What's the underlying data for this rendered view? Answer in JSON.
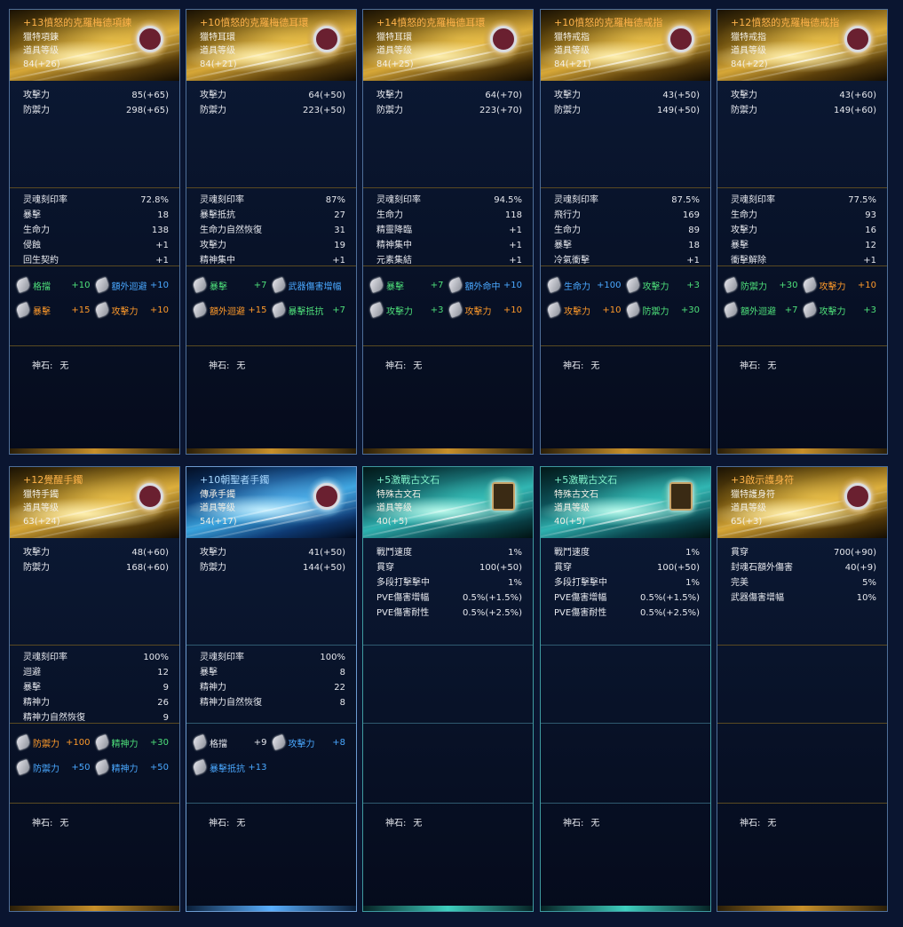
{
  "godstone_label": "神石:",
  "cards": [
    {
      "theme": "gold",
      "name": "+13憤怒的克羅梅德項鍊",
      "type": "獵特項鍊",
      "level_label": "道具等级",
      "level": "84(+26)",
      "icon": "necklace-icon",
      "base_stats": [
        {
          "k": "攻擊力",
          "v": "85(+65)"
        },
        {
          "k": "防禦力",
          "v": "298(+65)"
        }
      ],
      "bonus_stats": [
        {
          "k": "灵魂刻印率",
          "v": "72.8%"
        },
        {
          "k": "暴擊",
          "v": "18"
        },
        {
          "k": "生命力",
          "v": "138"
        },
        {
          "k": "侵蝕",
          "v": "+1"
        },
        {
          "k": "回生契約",
          "v": "+1"
        }
      ],
      "stones": [
        {
          "label": "格擋",
          "value": "+10",
          "color": "green"
        },
        {
          "label": "額外迴避",
          "value": "+10",
          "color": "blue"
        },
        {
          "label": "暴擊",
          "value": "+15",
          "color": "orange"
        },
        {
          "label": "攻擊力",
          "value": "+10",
          "color": "orange"
        }
      ],
      "godstone": "无"
    },
    {
      "theme": "gold",
      "name": "+10憤怒的克羅梅德耳環",
      "type": "獵特耳環",
      "level_label": "道具等级",
      "level": "84(+21)",
      "icon": "earring-icon",
      "base_stats": [
        {
          "k": "攻擊力",
          "v": "64(+50)"
        },
        {
          "k": "防禦力",
          "v": "223(+50)"
        }
      ],
      "bonus_stats": [
        {
          "k": "灵魂刻印率",
          "v": "87%"
        },
        {
          "k": "暴擊抵抗",
          "v": "27"
        },
        {
          "k": "生命力自然恢復",
          "v": "31"
        },
        {
          "k": "攻擊力",
          "v": "19"
        },
        {
          "k": "精神集中",
          "v": "+1"
        }
      ],
      "stones": [
        {
          "label": "暴擊",
          "value": "+7",
          "color": "green"
        },
        {
          "label": "武器傷害增幅",
          "value": "",
          "color": "blue"
        },
        {
          "label": "額外迴避",
          "value": "+15",
          "color": "orange"
        },
        {
          "label": "暴擊抵抗",
          "value": "+7",
          "color": "green"
        }
      ],
      "godstone": "无"
    },
    {
      "theme": "gold",
      "name": "+14憤怒的克羅梅德耳環",
      "type": "獵特耳環",
      "level_label": "道具等级",
      "level": "84(+25)",
      "icon": "earring-icon",
      "base_stats": [
        {
          "k": "攻擊力",
          "v": "64(+70)"
        },
        {
          "k": "防禦力",
          "v": "223(+70)"
        }
      ],
      "bonus_stats": [
        {
          "k": "灵魂刻印率",
          "v": "94.5%"
        },
        {
          "k": "生命力",
          "v": "118"
        },
        {
          "k": "精靈降臨",
          "v": "+1"
        },
        {
          "k": "精神集中",
          "v": "+1"
        },
        {
          "k": "元素集結",
          "v": "+1"
        }
      ],
      "stones": [
        {
          "label": "暴擊",
          "value": "+7",
          "color": "green"
        },
        {
          "label": "額外命中",
          "value": "+10",
          "color": "blue"
        },
        {
          "label": "攻擊力",
          "value": "+3",
          "color": "green"
        },
        {
          "label": "攻擊力",
          "value": "+10",
          "color": "orange"
        }
      ],
      "godstone": "无"
    },
    {
      "theme": "gold",
      "name": "+10憤怒的克羅梅德戒指",
      "type": "獵特戒指",
      "level_label": "道具等级",
      "level": "84(+21)",
      "icon": "ring-icon",
      "base_stats": [
        {
          "k": "攻擊力",
          "v": "43(+50)"
        },
        {
          "k": "防禦力",
          "v": "149(+50)"
        }
      ],
      "bonus_stats": [
        {
          "k": "灵魂刻印率",
          "v": "87.5%"
        },
        {
          "k": "飛行力",
          "v": "169"
        },
        {
          "k": "生命力",
          "v": "89"
        },
        {
          "k": "暴擊",
          "v": "18"
        },
        {
          "k": "冷氣衝擊",
          "v": "+1"
        }
      ],
      "stones": [
        {
          "label": "生命力",
          "value": "+100",
          "color": "blue"
        },
        {
          "label": "攻擊力",
          "value": "+3",
          "color": "green"
        },
        {
          "label": "攻擊力",
          "value": "+10",
          "color": "orange"
        },
        {
          "label": "防禦力",
          "value": "+30",
          "color": "green"
        }
      ],
      "godstone": "无"
    },
    {
      "theme": "gold",
      "name": "+12憤怒的克羅梅德戒指",
      "type": "獵特戒指",
      "level_label": "道具等级",
      "level": "84(+22)",
      "icon": "ring-icon",
      "base_stats": [
        {
          "k": "攻擊力",
          "v": "43(+60)"
        },
        {
          "k": "防禦力",
          "v": "149(+60)"
        }
      ],
      "bonus_stats": [
        {
          "k": "灵魂刻印率",
          "v": "77.5%"
        },
        {
          "k": "生命力",
          "v": "93"
        },
        {
          "k": "攻擊力",
          "v": "16"
        },
        {
          "k": "暴擊",
          "v": "12"
        },
        {
          "k": "衝擊解除",
          "v": "+1"
        }
      ],
      "stones": [
        {
          "label": "防禦力",
          "value": "+30",
          "color": "green"
        },
        {
          "label": "攻擊力",
          "value": "+10",
          "color": "orange"
        },
        {
          "label": "額外迴避",
          "value": "+7",
          "color": "green"
        },
        {
          "label": "攻擊力",
          "value": "+3",
          "color": "green"
        }
      ],
      "godstone": "无"
    },
    {
      "theme": "gold",
      "name": "+12覺醒手鐲",
      "type": "獵特手鐲",
      "level_label": "道具等级",
      "level": "63(+24)",
      "icon": "bracelet-icon",
      "base_stats": [
        {
          "k": "攻擊力",
          "v": "48(+60)"
        },
        {
          "k": "防禦力",
          "v": "168(+60)"
        }
      ],
      "bonus_stats": [
        {
          "k": "灵魂刻印率",
          "v": "100%"
        },
        {
          "k": "迴避",
          "v": "12"
        },
        {
          "k": "暴擊",
          "v": "9"
        },
        {
          "k": "精神力",
          "v": "26"
        },
        {
          "k": "精神力自然恢復",
          "v": "9"
        }
      ],
      "stones": [
        {
          "label": "防禦力",
          "value": "+100",
          "color": "orange"
        },
        {
          "label": "精神力",
          "value": "+30",
          "color": "green"
        },
        {
          "label": "防禦力",
          "value": "+50",
          "color": "blue"
        },
        {
          "label": "精神力",
          "value": "+50",
          "color": "blue"
        }
      ],
      "godstone": "无"
    },
    {
      "theme": "blue",
      "name": "+10朝聖者手鐲",
      "type": "傳承手鐲",
      "level_label": "道具等级",
      "level": "54(+17)",
      "icon": "bracelet-icon",
      "base_stats": [
        {
          "k": "攻擊力",
          "v": "41(+50)"
        },
        {
          "k": "防禦力",
          "v": "144(+50)"
        }
      ],
      "bonus_stats": [
        {
          "k": "灵魂刻印率",
          "v": "100%"
        },
        {
          "k": "暴擊",
          "v": "8"
        },
        {
          "k": "精神力",
          "v": "22"
        },
        {
          "k": "精神力自然恢復",
          "v": "8"
        }
      ],
      "stones": [
        {
          "label": "格擋",
          "value": "+9",
          "color": "white"
        },
        {
          "label": "攻擊力",
          "value": "+8",
          "color": "blue"
        },
        {
          "label": "暴擊抵抗",
          "value": "+13",
          "color": "blue"
        }
      ],
      "godstone": "无"
    },
    {
      "theme": "green",
      "name": "+5激戰古文石",
      "type": "特殊古文石",
      "level_label": "道具等级",
      "level": "40(+5)",
      "icon": "rune-stone-icon",
      "base_stats": [
        {
          "k": "戰鬥速度",
          "v": "1%"
        },
        {
          "k": "貫穿",
          "v": "100(+50)"
        },
        {
          "k": "多段打擊擊中",
          "v": "1%"
        },
        {
          "k": "PVE傷害增幅",
          "v": "0.5%(+1.5%)"
        },
        {
          "k": "PVE傷害耐性",
          "v": "0.5%(+2.5%)"
        }
      ],
      "bonus_stats": [],
      "stones": [],
      "godstone": "无"
    },
    {
      "theme": "green",
      "name": "+5激戰古文石",
      "type": "特殊古文石",
      "level_label": "道具等级",
      "level": "40(+5)",
      "icon": "rune-stone-icon",
      "base_stats": [
        {
          "k": "戰鬥速度",
          "v": "1%"
        },
        {
          "k": "貫穿",
          "v": "100(+50)"
        },
        {
          "k": "多段打擊擊中",
          "v": "1%"
        },
        {
          "k": "PVE傷害增幅",
          "v": "0.5%(+1.5%)"
        },
        {
          "k": "PVE傷害耐性",
          "v": "0.5%(+2.5%)"
        }
      ],
      "bonus_stats": [],
      "stones": [],
      "godstone": "无"
    },
    {
      "theme": "gold",
      "name": "+3啟示護身符",
      "type": "獵特護身符",
      "level_label": "道具等级",
      "level": "65(+3)",
      "icon": "amulet-icon",
      "base_stats": [
        {
          "k": "貫穿",
          "v": "700(+90)"
        },
        {
          "k": "封魂石額外傷害",
          "v": "40(+9)"
        },
        {
          "k": "完美",
          "v": "5%"
        },
        {
          "k": "武器傷害增幅",
          "v": "10%"
        }
      ],
      "bonus_stats": [],
      "stones": [],
      "godstone": "无"
    }
  ]
}
